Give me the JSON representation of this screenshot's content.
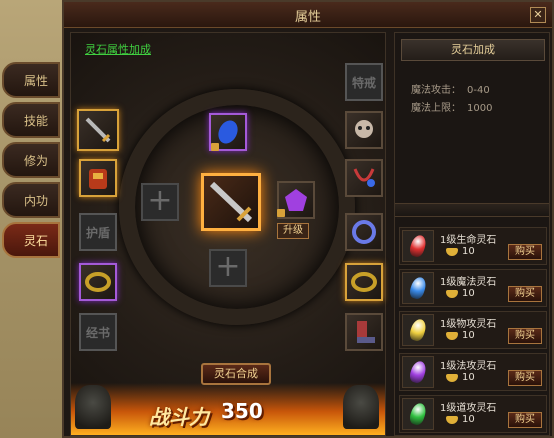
{
  "window": {
    "title": "属性",
    "close_label": "✕"
  },
  "side_tabs": [
    {
      "label": "属性",
      "active": false
    },
    {
      "label": "技能",
      "active": false
    },
    {
      "label": "修为",
      "active": false
    },
    {
      "label": "内功",
      "active": false
    },
    {
      "label": "灵石",
      "active": true
    }
  ],
  "equip": {
    "link_label": "灵石属性加成",
    "locked_slot_labels": [
      "护盾",
      "特戒",
      "经书"
    ],
    "upgrade_label": "升级",
    "combine_label": "灵石合成",
    "power_label": "战斗力",
    "power_value": "350"
  },
  "bonus": {
    "header": "灵石加成",
    "stats": [
      {
        "name": "魔法攻击：",
        "value": "0-40"
      },
      {
        "name": "魔法上限：",
        "value": "1000"
      }
    ]
  },
  "shop": {
    "items": [
      {
        "name": "1级生命灵石",
        "price": "10",
        "buy_label": "购买",
        "color": "#e03030"
      },
      {
        "name": "1级魔法灵石",
        "price": "10",
        "buy_label": "购买",
        "color": "#3a8ae8"
      },
      {
        "name": "1级物攻灵石",
        "price": "10",
        "buy_label": "购买",
        "color": "#f0d040"
      },
      {
        "name": "1级法攻灵石",
        "price": "10",
        "buy_label": "购买",
        "color": "#a040e0"
      },
      {
        "name": "1级道攻灵石",
        "price": "10",
        "buy_label": "购买",
        "color": "#30c040"
      }
    ]
  }
}
